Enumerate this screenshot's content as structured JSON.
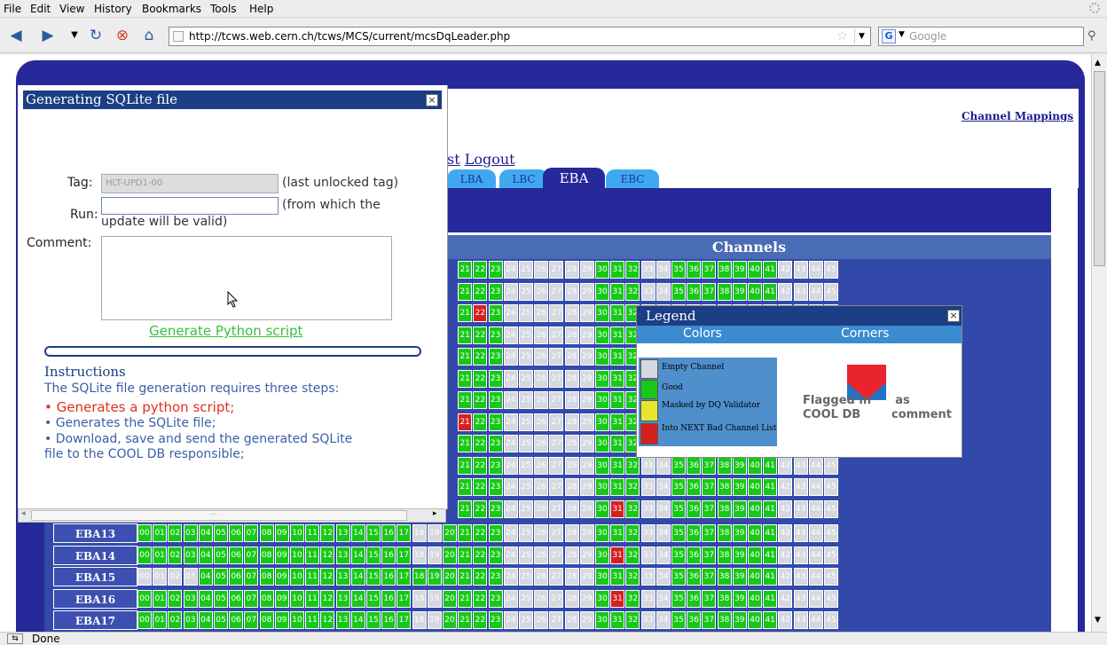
{
  "menu": {
    "file": "File",
    "edit": "Edit",
    "view": "View",
    "history": "History",
    "bookmarks": "Bookmarks",
    "tools": "Tools",
    "help": "Help"
  },
  "url": "http://tcws.web.cern.ch/tcws/MCS/current/mcsDqLeader.php",
  "search_placeholder": "Google",
  "channel_mappings": "Channel Mappings",
  "navlinks_text": "st",
  "logout": "Logout",
  "tabs": [
    "LBA",
    "LBC",
    "EBA",
    "EBC"
  ],
  "active_tab": "EBA",
  "channels_header": "Channels",
  "popup": {
    "title": "Generating SQLite file",
    "tag_label": "Tag:",
    "tag_value": "HLT-UPD1-00",
    "tag_note": "(last unlocked tag)",
    "run_label": "Run:",
    "run_note1": "(from which the",
    "run_note2": "update will be valid)",
    "comment_label": "Comment:",
    "generate_link": "Generate Python script",
    "instructions_title": "Instructions",
    "instructions": [
      "The SQLite file generation requires three steps:",
      "• Generates a python script;",
      "• Generates the SQLite file;",
      "• Download, save and send the generated SQLite",
      "file to the COOL DB responsible;"
    ],
    "scroll_dots": "..."
  },
  "legend": {
    "title": "Legend",
    "colors_header": "Colors",
    "corners_header": "Corners",
    "items": [
      {
        "label": "Empty Channel",
        "color": "#d5d8de"
      },
      {
        "label": "Good",
        "color": "#17c917"
      },
      {
        "label": "Masked by DQ Validator",
        "color": "#e6e62e"
      },
      {
        "label": "Into NEXT Bad Channel List",
        "color": "#d62020"
      }
    ],
    "flagged_line1": "Flagged in",
    "flagged_line2": "COOL DB",
    "has_text": "as",
    "comment_text": "comment"
  },
  "rows": [
    {
      "label": "EBA13",
      "red": [],
      "empty": [
        18,
        19,
        24,
        25,
        26,
        27,
        28,
        29,
        33,
        34,
        42,
        43,
        44,
        45
      ]
    },
    {
      "label": "EBA14",
      "red": [
        31
      ],
      "empty": [
        18,
        19,
        24,
        25,
        26,
        27,
        28,
        29,
        33,
        34,
        42,
        43,
        44,
        45
      ]
    },
    {
      "label": "EBA15",
      "red": [],
      "empty": [
        0,
        1,
        2,
        3,
        24,
        25,
        26,
        27,
        28,
        29,
        33,
        34,
        42,
        43,
        44,
        45
      ]
    },
    {
      "label": "EBA16",
      "red": [
        31
      ],
      "empty": [
        18,
        19,
        24,
        25,
        26,
        27,
        28,
        29,
        33,
        34,
        42,
        43,
        44,
        45
      ]
    },
    {
      "label": "EBA17",
      "red": [],
      "empty": [
        18,
        19,
        24,
        25,
        26,
        27,
        28,
        29,
        33,
        34,
        42,
        43,
        44,
        45
      ]
    }
  ],
  "status": "Done",
  "colors": {
    "good": "#17c917",
    "empty": "#d5d8de",
    "bad": "#d62020",
    "frame": "#27289a"
  }
}
